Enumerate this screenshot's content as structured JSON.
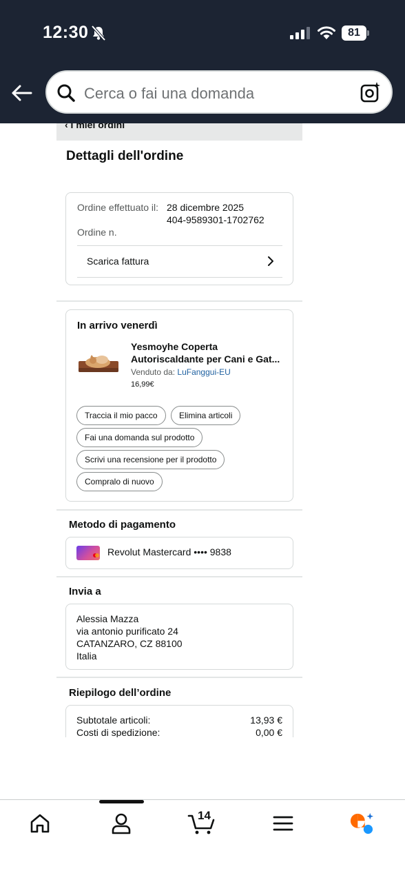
{
  "status_bar": {
    "time": "12:30",
    "battery": "81"
  },
  "search": {
    "placeholder": "Cerca o fai una domanda"
  },
  "breadcrumb": "‹ I miei ordini",
  "page_title": "Dettagli dell'ordine",
  "order": {
    "placed_label": "Ordine effettuato il:",
    "placed_value": "28 dicembre 2025",
    "number_label": "Ordine n.",
    "number_value": "404-9589301-1702762",
    "invoice_label": "Scarica fattura"
  },
  "shipment": {
    "status": "In arrivo venerdì",
    "product_title": "Yesmoyhe Coperta Autoriscaldante per Cani e Gat...",
    "sold_by_label": "Venduto da:",
    "seller": "LuFanggui-EU",
    "price": "16,99€",
    "actions": [
      "Traccia il mio pacco",
      "Elimina articoli",
      "Fai una domanda sul prodotto",
      "Scrivi una recensione per il prodotto",
      "Compralo di nuovo"
    ]
  },
  "payment": {
    "heading": "Metodo di pagamento",
    "card": "Revolut Mastercard •••• 9838"
  },
  "ship_to": {
    "heading": "Invia a",
    "lines": [
      "Alessia Mazza",
      "via antonio purificato 24",
      "CATANZARO, CZ 88100",
      "Italia"
    ]
  },
  "summary": {
    "heading": "Riepilogo dell’ordine",
    "rows": [
      {
        "label": "Subtotale articoli:",
        "value": "13,93 €"
      },
      {
        "label": "Costi di spedizione:",
        "value": "0,00 €"
      }
    ]
  },
  "bottom_nav": {
    "cart_count": "14"
  },
  "colors": {
    "header_bg": "#1c2433",
    "link": "#2162a1",
    "ai_orange": "#ff6a00",
    "ai_blue": "#1a98ff"
  }
}
